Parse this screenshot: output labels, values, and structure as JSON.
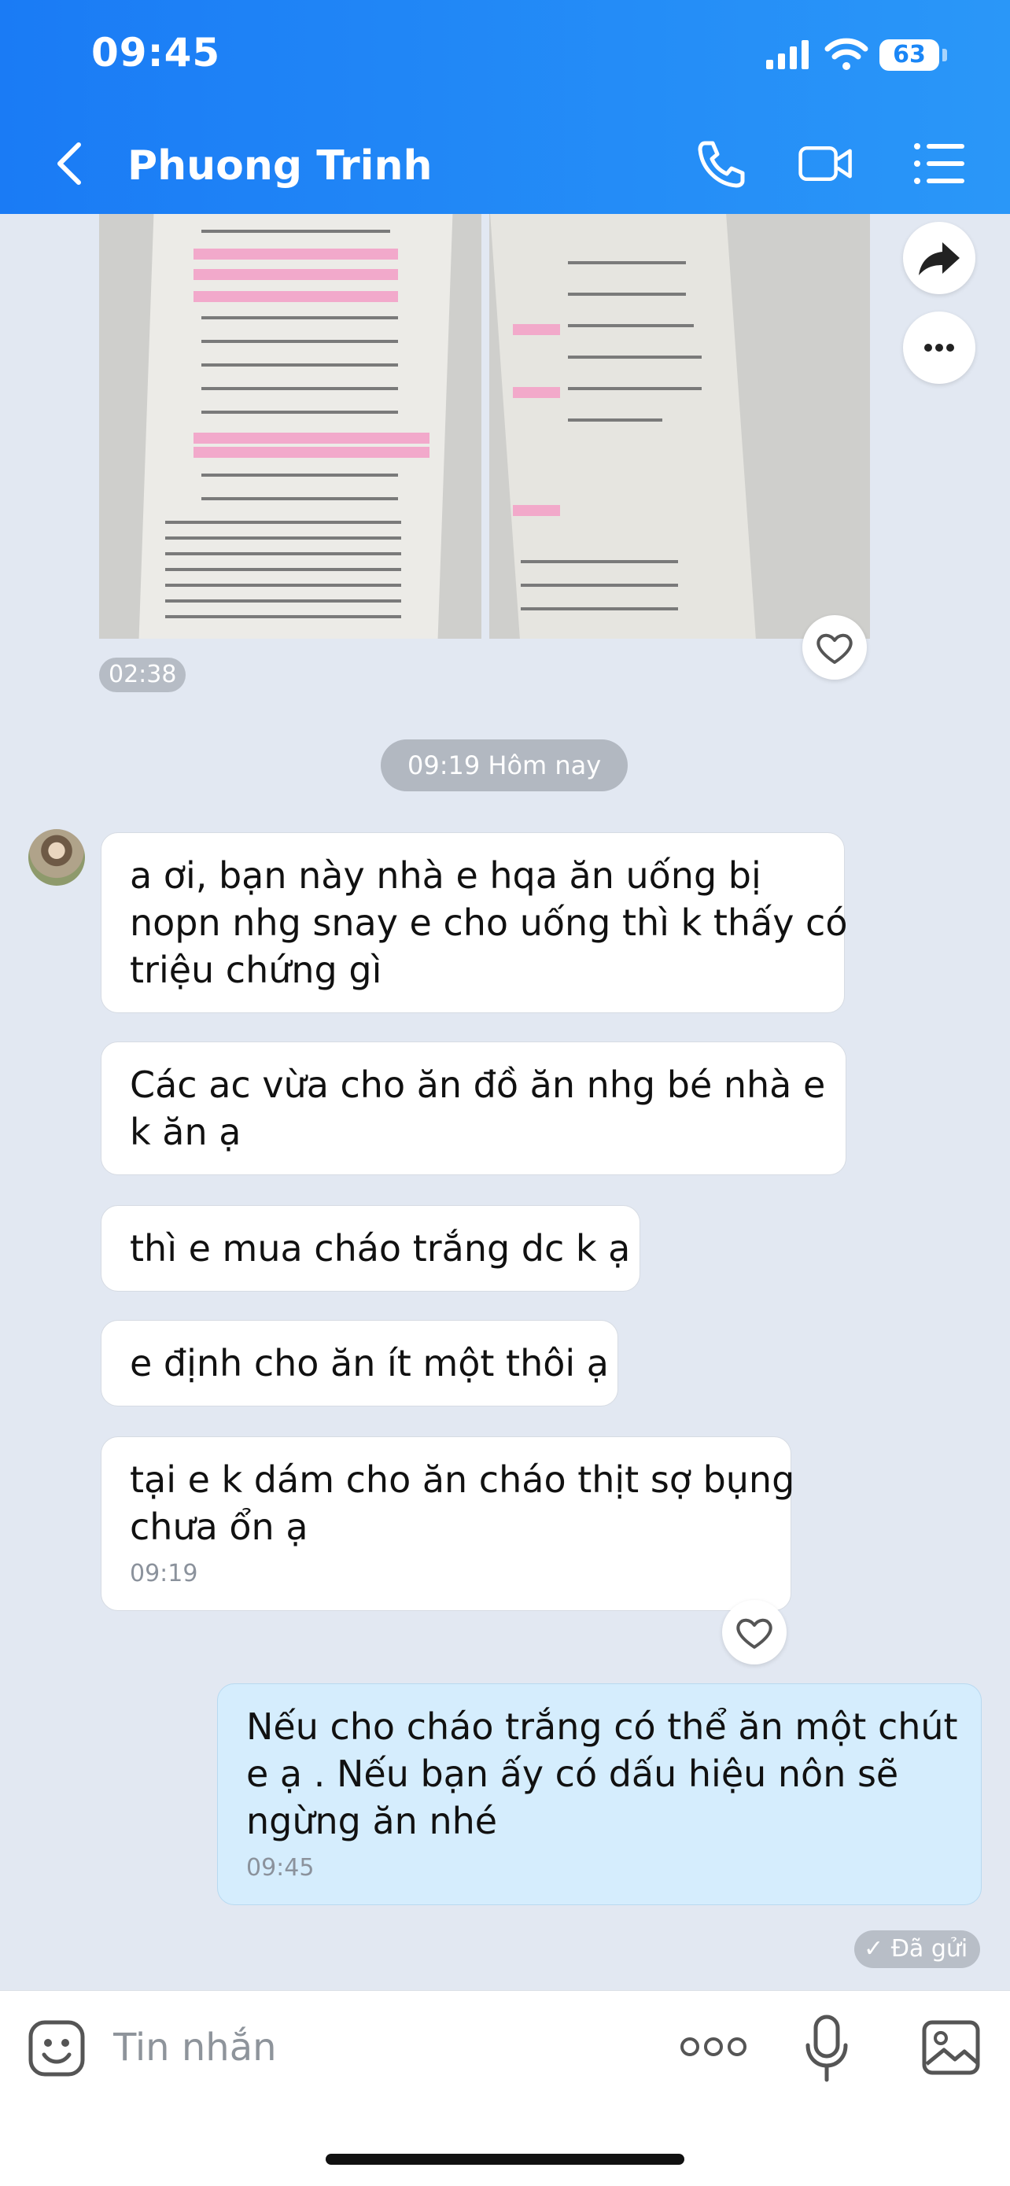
{
  "status_bar": {
    "time": "09:45",
    "battery": "63"
  },
  "header": {
    "contact_name": "Phuong Trinh"
  },
  "photo_message": {
    "time": "02:38"
  },
  "date_separator": "09:19 Hôm nay",
  "received_messages": [
    {
      "lines": [
        "a ơi, bạn này nhà e hqa ăn uống bị",
        "nopn nhg snay e cho uống thì k thấy có",
        "triệu chứng gì"
      ]
    },
    {
      "lines": [
        "Các ac vừa cho ăn đồ ăn nhg bé nhà e",
        "k ăn ạ"
      ]
    },
    {
      "lines": [
        "thì e mua cháo trắng dc k ạ"
      ]
    },
    {
      "lines": [
        "e định cho ăn ít một thôi ạ"
      ]
    },
    {
      "lines": [
        "tại e k dám cho ăn cháo thịt sợ bụng",
        "chưa ổn ạ"
      ],
      "time": "09:19"
    }
  ],
  "sent_message": {
    "lines": [
      "Nếu cho cháo trắng có thể ăn một chút",
      "e ạ . Nếu bạn ấy có dấu hiệu nôn sẽ",
      "ngừng ăn nhé"
    ],
    "time": "09:45",
    "status": "Đã gửi"
  },
  "input": {
    "placeholder": "Tin nhắn"
  },
  "colors": {
    "header_start": "#1a7bf5",
    "header_end": "#2a97f8",
    "sent_bubble": "#d5edfd",
    "chat_bg": "#e2e8f2"
  }
}
